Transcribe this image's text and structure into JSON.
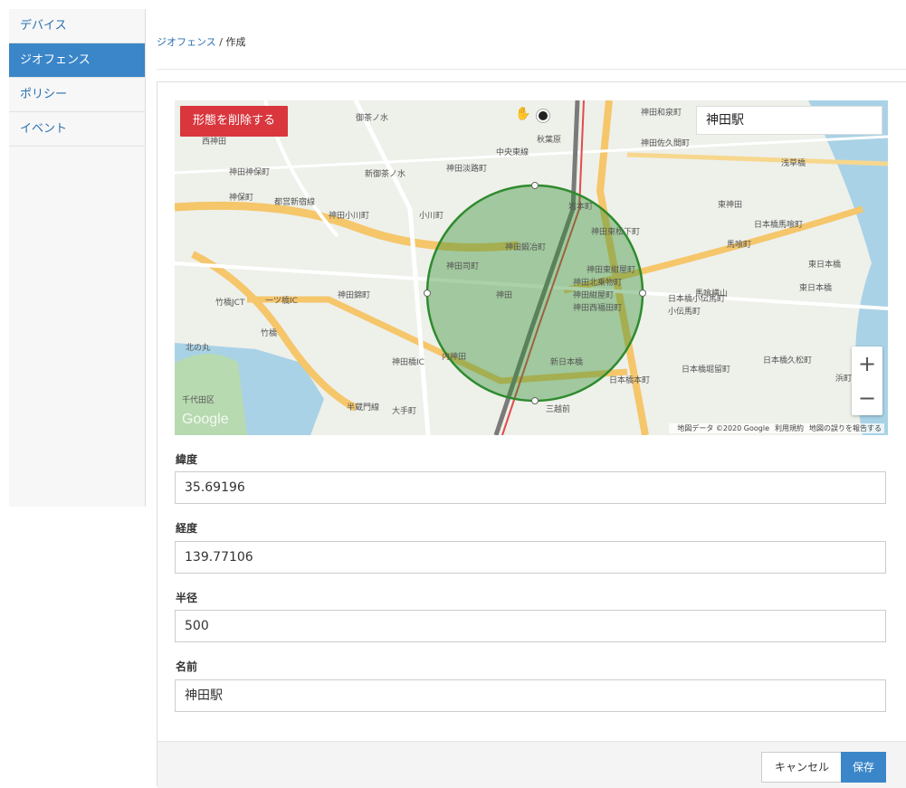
{
  "sidebar": {
    "items": [
      {
        "label": "デバイス"
      },
      {
        "label": "ジオフェンス"
      },
      {
        "label": "ポリシー"
      },
      {
        "label": "イベント"
      }
    ]
  },
  "breadcrumb": {
    "parent": "ジオフェンス",
    "separator": " / ",
    "current": "作成"
  },
  "map": {
    "delete_shape_label": "形態を削除する",
    "search_value": "神田駅",
    "zoom_in": "+",
    "zoom_out": "−",
    "logo": "Google",
    "attribution": "地図データ ©2020 Google",
    "terms": "利用規約",
    "report": "地図の誤りを報告する",
    "labels": [
      "御茶ノ水",
      "秋葉原",
      "神田和泉町",
      "神田佐久間町",
      "浅草橋",
      "西神田",
      "神田神保町",
      "新御茶ノ水",
      "神田淡路町",
      "都営新宿線",
      "神保町",
      "神田小川町",
      "小川町",
      "岩本町",
      "東神田",
      "日本橋馬喰町",
      "馬喰町",
      "東日本橋",
      "神田司町",
      "神田鍛冶町",
      "神田東松下町",
      "神田東紺屋町",
      "神田北乗物町",
      "神田紺屋町",
      "神田西福田町",
      "神田",
      "神田錦町",
      "日本橋小伝馬町",
      "小伝馬町",
      "馬喰横山",
      "東日本橋",
      "竹橋JCT",
      "一ツ橋IC",
      "竹橋",
      "北の丸",
      "内神田",
      "神田橋IC",
      "新日本橋",
      "日本橋本町",
      "日本橋堀留町",
      "日本橋久松町",
      "千代田区",
      "三越前",
      "大手町",
      "半蔵門線",
      "浜町",
      "中央東線"
    ],
    "accent": "#2e8b2e"
  },
  "form": {
    "fields": [
      {
        "label": "緯度",
        "value": "35.69196"
      },
      {
        "label": "経度",
        "value": "139.77106"
      },
      {
        "label": "半径",
        "value": "500"
      },
      {
        "label": "名前",
        "value": "神田駅"
      }
    ]
  },
  "footer": {
    "cancel_label": "キャンセル",
    "save_label": "保存"
  },
  "colors": {
    "primary": "#3a86c8",
    "danger": "#d9363e",
    "geofence": "#2e8b2e"
  }
}
